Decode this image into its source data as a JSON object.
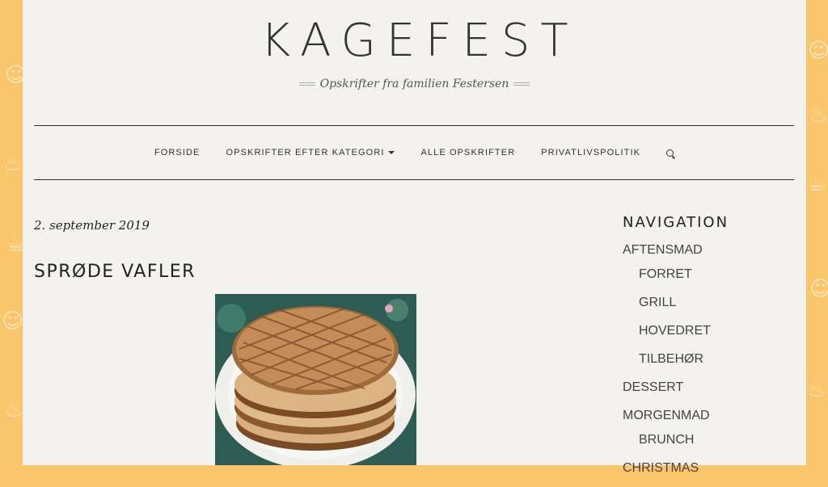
{
  "site": {
    "title": "KAGEFEST",
    "tagline": "Opskrifter fra familien Festersen"
  },
  "nav": {
    "items": [
      {
        "label": "FORSIDE"
      },
      {
        "label": "OPSKRIFTER EFTER KATEGORI",
        "icon": "caret-down-icon"
      },
      {
        "label": "ALLE OPSKRIFTER"
      },
      {
        "label": "PRIVATLIVSPOLITIK"
      }
    ],
    "search_icon": "search-icon"
  },
  "post": {
    "date": "2. september 2019",
    "title": "SPRØDE VAFLER",
    "image": "waffle-stack-photo"
  },
  "sidebar": {
    "widget_title": "NAVIGATION",
    "items": [
      {
        "label": "AFTENSMAD",
        "level": 0
      },
      {
        "label": "FORRET",
        "level": 1
      },
      {
        "label": "GRILL",
        "level": 1
      },
      {
        "label": "HOVEDRET",
        "level": 1
      },
      {
        "label": "TILBEHØR",
        "level": 1
      },
      {
        "label": "DESSERT",
        "level": 0
      },
      {
        "label": "MORGENMAD",
        "level": 0
      },
      {
        "label": "BRUNCH",
        "level": 1
      },
      {
        "label": "CHRISTMAS",
        "level": 0
      }
    ]
  },
  "colors": {
    "background_accent": "#f9c66b",
    "page_background": "#f3f2ef",
    "text": "#333333"
  }
}
